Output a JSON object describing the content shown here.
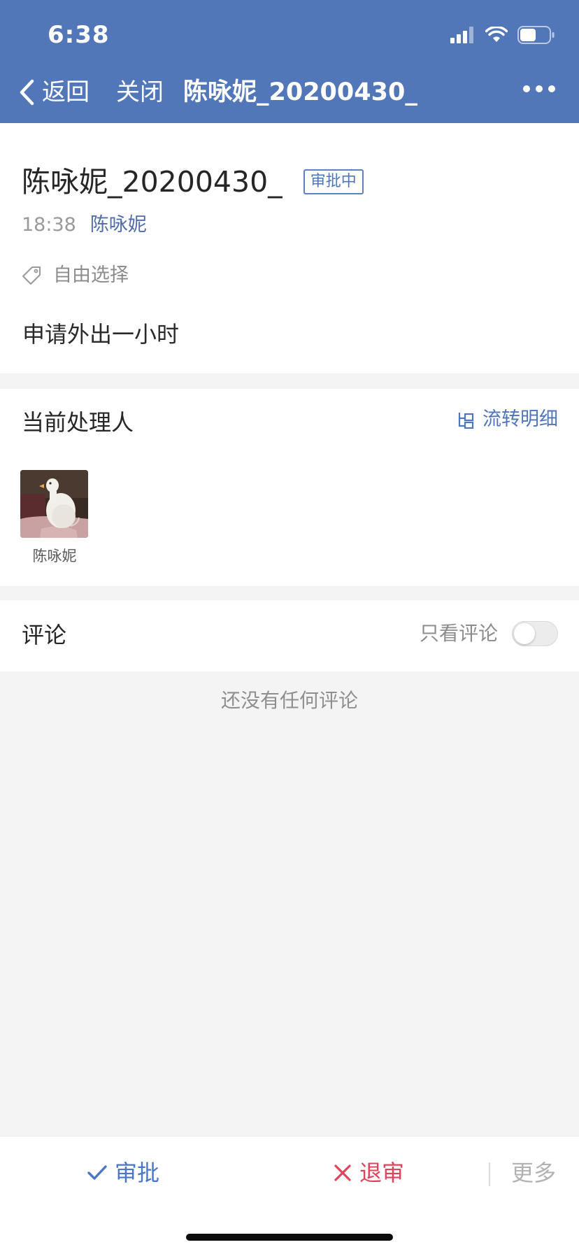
{
  "status_bar": {
    "time": "6:38"
  },
  "nav": {
    "back_label": "返回",
    "close_label": "关闭",
    "title": "陈咏妮_20200430_"
  },
  "doc": {
    "title": "陈咏妮_20200430_",
    "status": "审批中",
    "time": "18:38",
    "author": "陈咏妮",
    "tag": "自由选择",
    "body": "申请外出一小时"
  },
  "handler": {
    "section_title": "当前处理人",
    "flow_link": "流转明细",
    "people": [
      {
        "name": "陈咏妮"
      }
    ]
  },
  "comments": {
    "section_title": "评论",
    "filter_label": "只看评论",
    "filter_on": false,
    "empty_text": "还没有任何评论"
  },
  "actions": {
    "approve": "审批",
    "reject": "退审",
    "more": "更多"
  },
  "colors": {
    "header_bg": "#5277b9",
    "link": "#4f76bb",
    "approve": "#4a76c6",
    "reject": "#e0445a"
  },
  "icons": {
    "back": "chevron-left-icon",
    "more": "more-dots-icon",
    "tag": "tag-icon",
    "flow": "flow-chart-icon",
    "approve": "check-icon",
    "reject": "x-icon",
    "signal": "signal-icon",
    "wifi": "wifi-icon",
    "battery": "battery-icon"
  }
}
